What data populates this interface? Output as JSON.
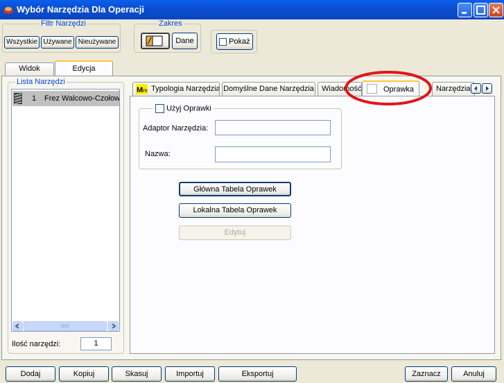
{
  "window": {
    "title": "Wybór Narzędzia Dla Operacji"
  },
  "filter": {
    "title": "Filtr Narzędzi",
    "buttons": [
      "Wszystkie",
      "Używane",
      "Nieużywane"
    ]
  },
  "range": {
    "title": "Zakres",
    "data_button": "Dane"
  },
  "show_button": "Pokaż",
  "outer_tabs": [
    "Widok",
    "Edycja"
  ],
  "tool_list": {
    "title": "Lista Narzędzi",
    "rows": [
      {
        "num": "1",
        "name": "Frez Walcowo-Czołowy"
      }
    ],
    "count_label": "Ilość narzędzi:",
    "count_value": "1"
  },
  "inner_tabs": [
    "Typologia Narzędzia",
    "Domyślne Dane Narzędzia",
    "Wiadomość",
    "Oprawka",
    "Narzędzia"
  ],
  "holder": {
    "use_label": "Użyj Oprawki",
    "adapter_label": "Adaptor Narzędzia:",
    "adapter_value": "",
    "name_label": "Nazwa:",
    "name_value": "",
    "main_table_button": "Główna Tabela Oprawek",
    "local_table_button": "Lokalna Tabela Oprawek",
    "edit_button": "Edytuj"
  },
  "bottom_buttons": {
    "add": "Dodaj",
    "copy": "Kopiuj",
    "delete": "Skasuj",
    "import": "Importuj",
    "export": "Eksportuj",
    "select": "Zaznacz",
    "cancel": "Anuluj"
  },
  "annotation_color": "#E0161A"
}
